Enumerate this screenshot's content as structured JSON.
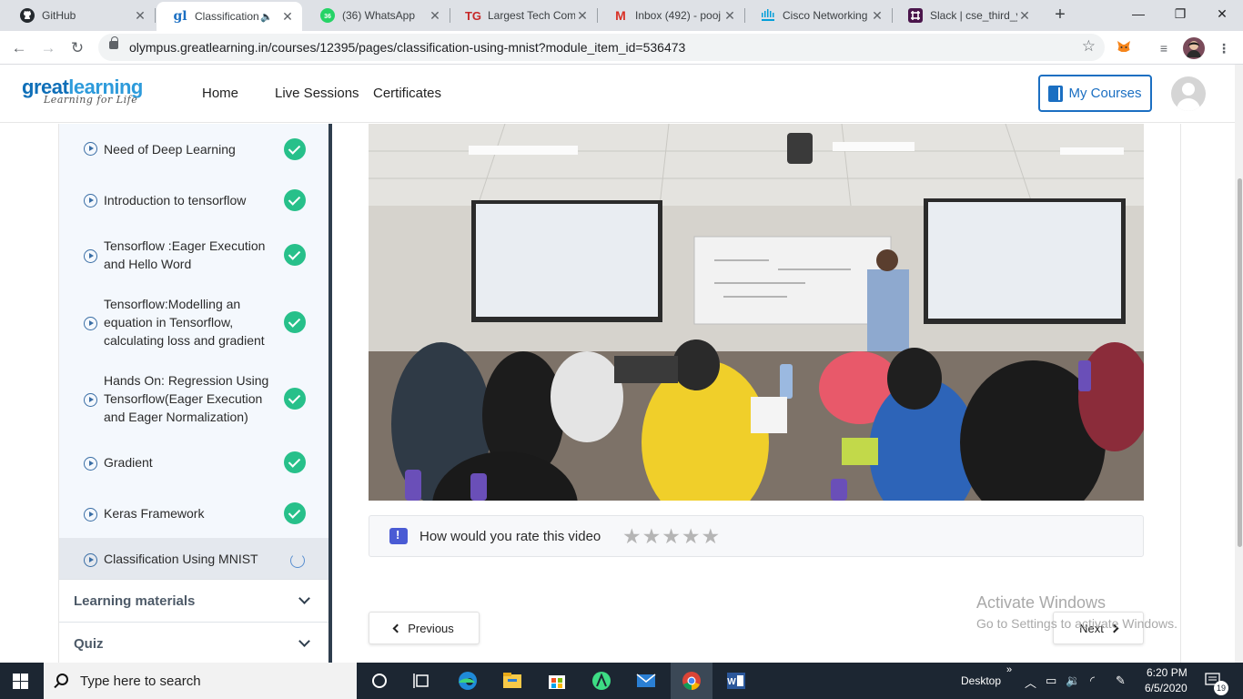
{
  "browser": {
    "tabs": [
      {
        "title": "GitHub",
        "favicon": "github-icon",
        "active": false
      },
      {
        "title": "Classification",
        "favicon": "greatlearning-icon",
        "active": true
      },
      {
        "title": "(36) WhatsApp",
        "favicon": "whatsapp-icon",
        "badge": "36",
        "active": false
      },
      {
        "title": "Largest Tech Comm",
        "favicon": "tg-icon",
        "favicon_text": "TG",
        "active": false
      },
      {
        "title": "Inbox (492) - pooj",
        "favicon": "gmail-icon",
        "favicon_text": "M",
        "active": false
      },
      {
        "title": "Cisco Networking",
        "favicon": "cisco-icon",
        "active": false
      },
      {
        "title": "Slack | cse_third_ye",
        "favicon": "slack-icon",
        "active": false
      }
    ],
    "url": "olympus.greatlearning.in/courses/12395/pages/classification-using-mnist?module_item_id=536473"
  },
  "site": {
    "logo": {
      "part1": "great",
      "part2": "learning",
      "tagline": "Learning for Life"
    },
    "nav": [
      "Home",
      "Live Sessions",
      "Certificates"
    ],
    "my_courses": "My Courses"
  },
  "sidebar": {
    "lessons": [
      {
        "label": "Need of Deep Learning",
        "status": "complete"
      },
      {
        "label": "Introduction to tensorflow",
        "status": "complete"
      },
      {
        "label": "Tensorflow :Eager Execution and Hello Word",
        "status": "complete"
      },
      {
        "label": "Tensorflow:Modelling an equation in Tensorflow, calculating loss and gradient",
        "status": "complete"
      },
      {
        "label": "Hands On: Regression Using Tensorflow(Eager Execution and Eager Normalization)",
        "status": "complete"
      },
      {
        "label": "Gradient",
        "status": "complete"
      },
      {
        "label": "Keras Framework",
        "status": "complete"
      },
      {
        "label": "Classification Using MNIST",
        "status": "in-progress"
      }
    ],
    "sections": [
      "Learning materials",
      "Quiz"
    ]
  },
  "main": {
    "rating_question": "How would you rate this video",
    "rating_value": 0,
    "rating_max": 5,
    "previous": "Previous",
    "next": "Next"
  },
  "watermark": {
    "line1": "Activate Windows",
    "line2": "Go to Settings to activate Windows."
  },
  "taskbar": {
    "search_placeholder": "Type here to search",
    "desktop_label": "Desktop",
    "time": "6:20 PM",
    "date": "6/5/2020",
    "notification_count": "19"
  },
  "colors": {
    "brand_blue": "#1b6fc2",
    "check_green": "#27c08a",
    "sidebar_bg": "#f4f8fd",
    "taskbar": "#1c2632"
  }
}
